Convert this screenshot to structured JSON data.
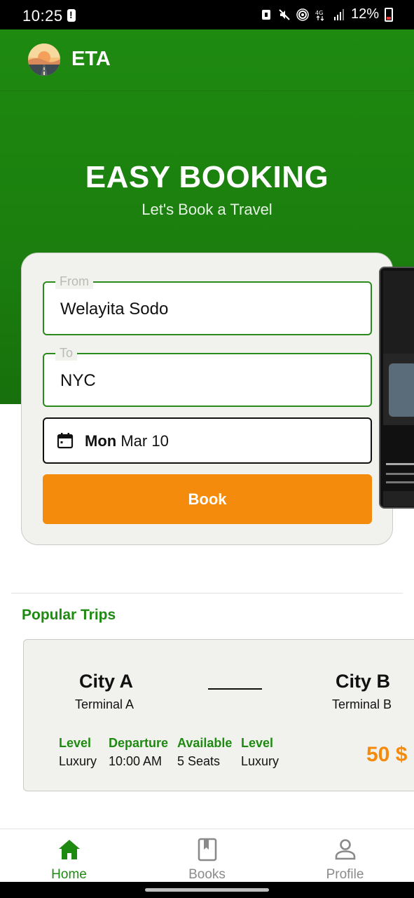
{
  "status_bar": {
    "time": "10:25",
    "battery": "12%",
    "network": "4G"
  },
  "app_bar": {
    "title": "ETA"
  },
  "hero": {
    "title": "EASY BOOKING",
    "subtitle": "Let's Book a Travel"
  },
  "booking_form": {
    "from_label": "From",
    "from_value": "Welayita Sodo",
    "to_label": "To",
    "to_value": "NYC",
    "date_day": "Mon",
    "date_rest": "Mar 10",
    "book_label": "Book"
  },
  "popular_trips": {
    "title": "Popular Trips",
    "trips": [
      {
        "from_city": "City A",
        "from_terminal": "Terminal A",
        "to_city": "City B",
        "to_terminal": "Terminal B",
        "details": [
          {
            "label": "Level",
            "value": "Luxury"
          },
          {
            "label": "Departure",
            "value": "10:00 AM"
          },
          {
            "label": "Available",
            "value": "5 Seats"
          },
          {
            "label": "Level",
            "value": "Luxury"
          }
        ],
        "price": "50 $"
      }
    ]
  },
  "bottom_nav": {
    "items": [
      {
        "label": "Home",
        "icon": "home-icon",
        "active": true
      },
      {
        "label": "Books",
        "icon": "book-icon",
        "active": false
      },
      {
        "label": "Profile",
        "icon": "person-icon",
        "active": false
      }
    ]
  },
  "colors": {
    "primary_green": "#1e8a10",
    "accent_orange": "#f58b0c",
    "card_bg": "#f1f2ee"
  }
}
